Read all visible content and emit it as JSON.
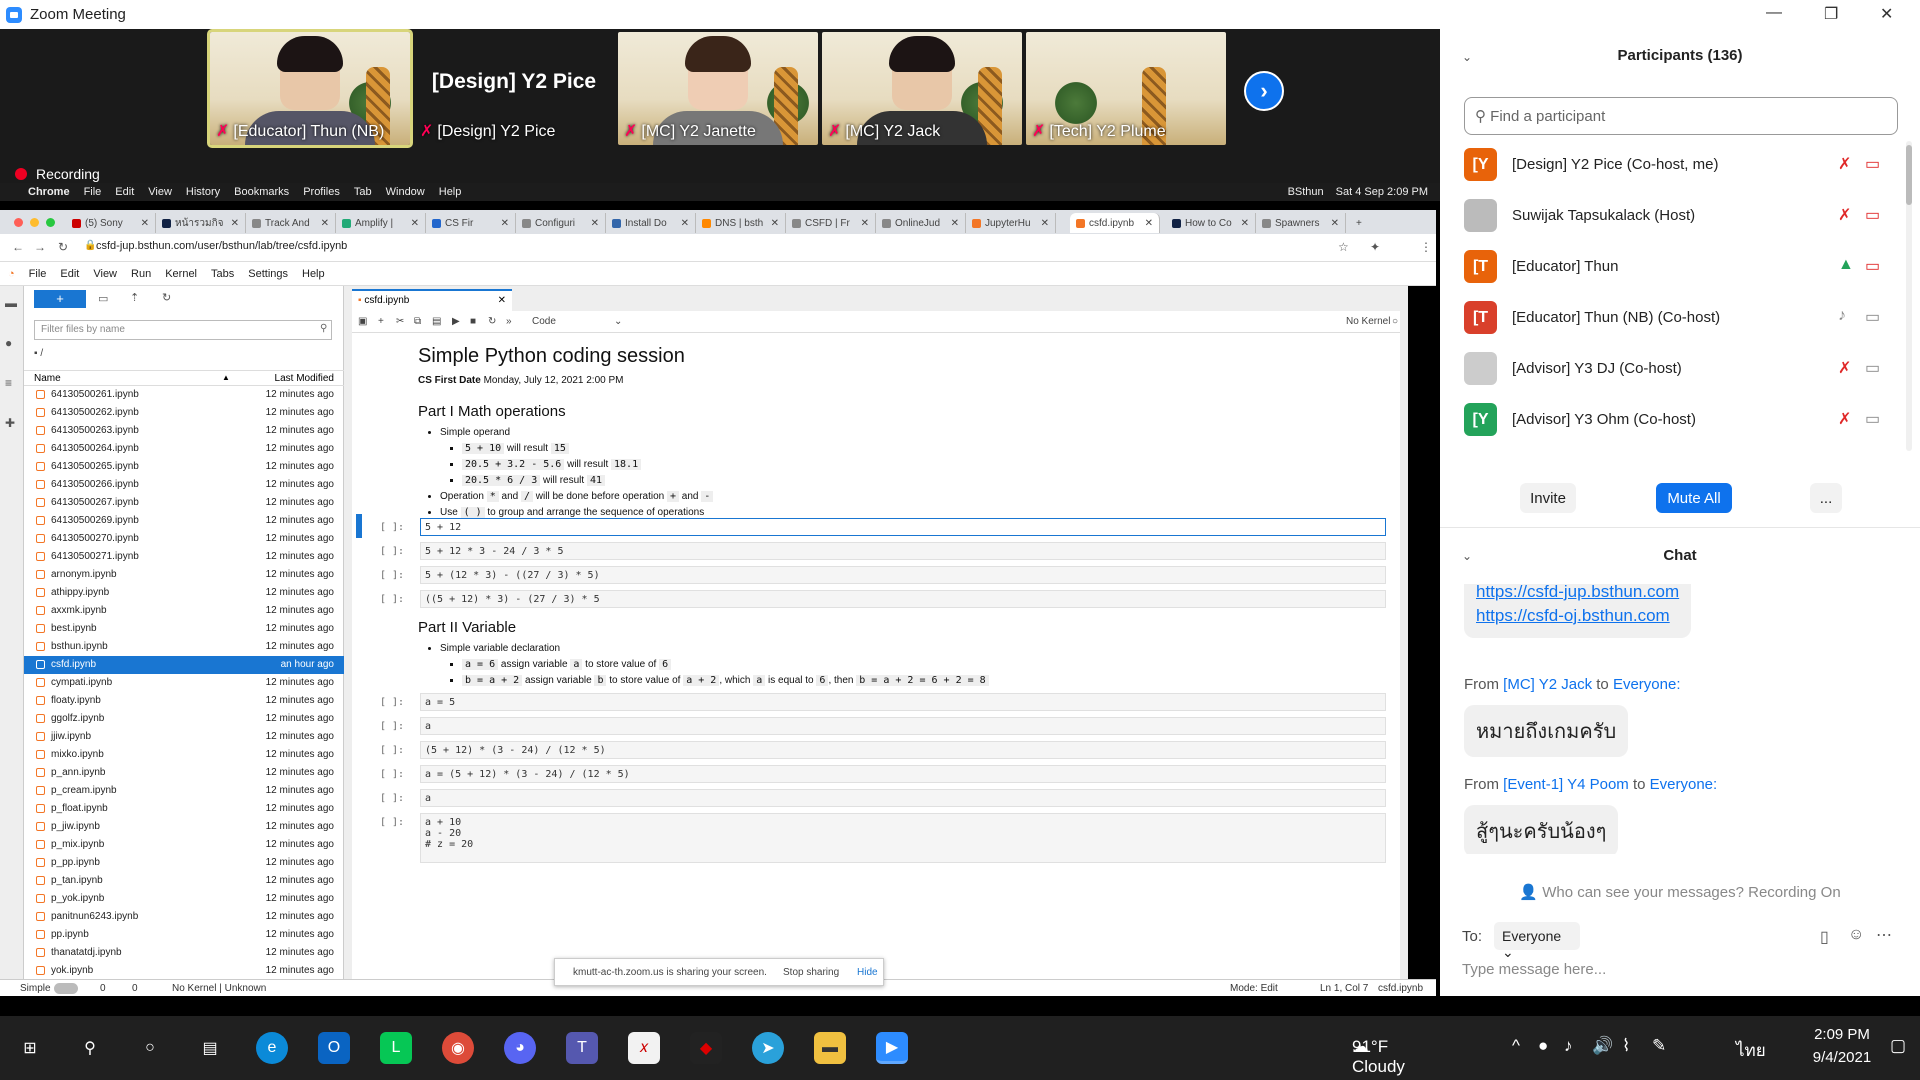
{
  "window": {
    "title": "Zoom Meeting",
    "min": "—",
    "max": "❐",
    "close": "✕"
  },
  "gallery": {
    "tiles": [
      {
        "name": "[Educator] Thun (NB)"
      },
      {
        "name": "[Design] Y2 Pice",
        "big": "[Design] Y2 Pice"
      },
      {
        "name": "[MC] Y2 Janette"
      },
      {
        "name": "[MC] Y2 Jack"
      },
      {
        "name": "[Tech] Y2 Plume"
      }
    ],
    "next": "›"
  },
  "recording": "Recording",
  "mac": {
    "apple": "",
    "menus": [
      "Chrome",
      "File",
      "Edit",
      "View",
      "History",
      "Bookmarks",
      "Profiles",
      "Tab",
      "Window",
      "Help"
    ],
    "right": [
      "BSthun",
      "Sat 4 Sep  2:09 PM"
    ]
  },
  "chrome": {
    "tabs": [
      "(5) Sony",
      "หน้ารวมกิจ",
      "Track And",
      "Amplify |",
      "CS Fir",
      "Configuri",
      "Install Do",
      "DNS | bsth",
      "CSFD | Fr",
      "OnlineJud",
      "JupyterHu",
      "csfd.ipynb",
      "How to Co",
      "Spawners"
    ],
    "url": "csfd-jup.bsthun.com/user/bsthun/lab/tree/csfd.ipynb"
  },
  "jupyter": {
    "menu": [
      "File",
      "Edit",
      "View",
      "Run",
      "Kernel",
      "Tabs",
      "Settings",
      "Help"
    ],
    "filter_placeholder": "Filter files by name",
    "path": "/",
    "col_name": "Name",
    "col_modified": "Last Modified",
    "files": [
      {
        "n": "64130500261.ipynb",
        "m": "12 minutes ago"
      },
      {
        "n": "64130500262.ipynb",
        "m": "12 minutes ago"
      },
      {
        "n": "64130500263.ipynb",
        "m": "12 minutes ago"
      },
      {
        "n": "64130500264.ipynb",
        "m": "12 minutes ago"
      },
      {
        "n": "64130500265.ipynb",
        "m": "12 minutes ago"
      },
      {
        "n": "64130500266.ipynb",
        "m": "12 minutes ago"
      },
      {
        "n": "64130500267.ipynb",
        "m": "12 minutes ago"
      },
      {
        "n": "64130500269.ipynb",
        "m": "12 minutes ago"
      },
      {
        "n": "64130500270.ipynb",
        "m": "12 minutes ago"
      },
      {
        "n": "64130500271.ipynb",
        "m": "12 minutes ago"
      },
      {
        "n": "arnonym.ipynb",
        "m": "12 minutes ago"
      },
      {
        "n": "athippy.ipynb",
        "m": "12 minutes ago"
      },
      {
        "n": "axxmk.ipynb",
        "m": "12 minutes ago"
      },
      {
        "n": "best.ipynb",
        "m": "12 minutes ago"
      },
      {
        "n": "bsthun.ipynb",
        "m": "12 minutes ago"
      },
      {
        "n": "csfd.ipynb",
        "m": "an hour ago"
      },
      {
        "n": "cympati.ipynb",
        "m": "12 minutes ago"
      },
      {
        "n": "floaty.ipynb",
        "m": "12 minutes ago"
      },
      {
        "n": "ggolfz.ipynb",
        "m": "12 minutes ago"
      },
      {
        "n": "jjiw.ipynb",
        "m": "12 minutes ago"
      },
      {
        "n": "mixko.ipynb",
        "m": "12 minutes ago"
      },
      {
        "n": "p_ann.ipynb",
        "m": "12 minutes ago"
      },
      {
        "n": "p_cream.ipynb",
        "m": "12 minutes ago"
      },
      {
        "n": "p_float.ipynb",
        "m": "12 minutes ago"
      },
      {
        "n": "p_jiw.ipynb",
        "m": "12 minutes ago"
      },
      {
        "n": "p_mix.ipynb",
        "m": "12 minutes ago"
      },
      {
        "n": "p_pp.ipynb",
        "m": "12 minutes ago"
      },
      {
        "n": "p_tan.ipynb",
        "m": "12 minutes ago"
      },
      {
        "n": "p_yok.ipynb",
        "m": "12 minutes ago"
      },
      {
        "n": "panitnun6243.ipynb",
        "m": "12 minutes ago"
      },
      {
        "n": "pp.ipynb",
        "m": "12 minutes ago"
      },
      {
        "n": "thanatatdj.ipynb",
        "m": "12 minutes ago"
      },
      {
        "n": "yok.ipynb",
        "m": "12 minutes ago"
      }
    ],
    "selected_file": "csfd.ipynb",
    "notebook_tab": "csfd.ipynb",
    "celltype": "Code",
    "kernel": "No Kernel",
    "title": "Simple Python coding session",
    "date_label": "CS First Date",
    "date_value": "Monday, July 12, 2021 2:00 PM",
    "part1": "Part I Math operations",
    "part2": "Part II Variable",
    "prompt": "[ ]:",
    "cells1": [
      "5 + 12",
      "5 + 12 * 3 - 24 / 3 * 5",
      "5 + (12 * 3) - ((27 / 3) * 5)",
      "((5 + 12) * 3) - (27 / 3) * 5"
    ],
    "cells2": [
      "a = 5",
      "a",
      "(5 + 12) * (3 - 24) / (12 * 5)",
      "a = (5 + 12) * (3 - 24) / (12 * 5)",
      "a",
      "a + 10\na - 20\n# z = 20"
    ],
    "status": {
      "mode": "Simple",
      "n1": "0",
      "n2": "0",
      "kernel": "No Kernel | Unknown",
      "edit": "Mode: Edit",
      "pos": "Ln 1, Col 7",
      "file": "csfd.ipynb"
    },
    "share_note": "kmutt-ac-th.zoom.us is sharing your screen.",
    "stop": "Stop sharing",
    "hide": "Hide"
  },
  "panel": {
    "participants_title": "Participants (136)",
    "find_placeholder": "Find a participant",
    "participants": [
      {
        "initial": "[Y",
        "name": "[Design] Y2 Pice (Co-host, me)",
        "color": "#e8630a"
      },
      {
        "initial": "",
        "name": "Suwijak Tapsukalack (Host)",
        "color": "#bbbbbb"
      },
      {
        "initial": "[T",
        "name": "[Educator] Thun",
        "color": "#e8630a"
      },
      {
        "initial": "[T",
        "name": "[Educator] Thun (NB) (Co-host)",
        "color": "#d9402b"
      },
      {
        "initial": "",
        "name": "[Advisor] Y3 DJ (Co-host)",
        "color": "#cccccc"
      },
      {
        "initial": "[Y",
        "name": "[Advisor] Y3 Ohm (Co-host)",
        "color": "#23a35a"
      }
    ],
    "invite": "Invite",
    "mute_all": "Mute All",
    "more": "...",
    "chat_title": "Chat",
    "links": [
      "https://csfd-jup.bsthun.com",
      "https://csfd-oj.bsthun.com"
    ],
    "msgs": [
      {
        "from_word": "From",
        "sender": "[MC] Y2 Jack",
        "to_word": "to",
        "target": "Everyone:",
        "text": "หมายถึงเกมครับ"
      },
      {
        "from_word": "From",
        "sender": "[Event-1] Y4 Poom",
        "to_word": "to",
        "target": "Everyone:",
        "text": "สู้ๆนะครับน้องๆ"
      }
    ],
    "visibility": "Who can see your messages? Recording On",
    "to_label": "To:",
    "to_value": "Everyone",
    "message_placeholder": "Type message here..."
  },
  "tray": {
    "weather": "91°F  Cloudy",
    "lang": "ไทย",
    "time": "2:09 PM",
    "date": "9/4/2021"
  }
}
